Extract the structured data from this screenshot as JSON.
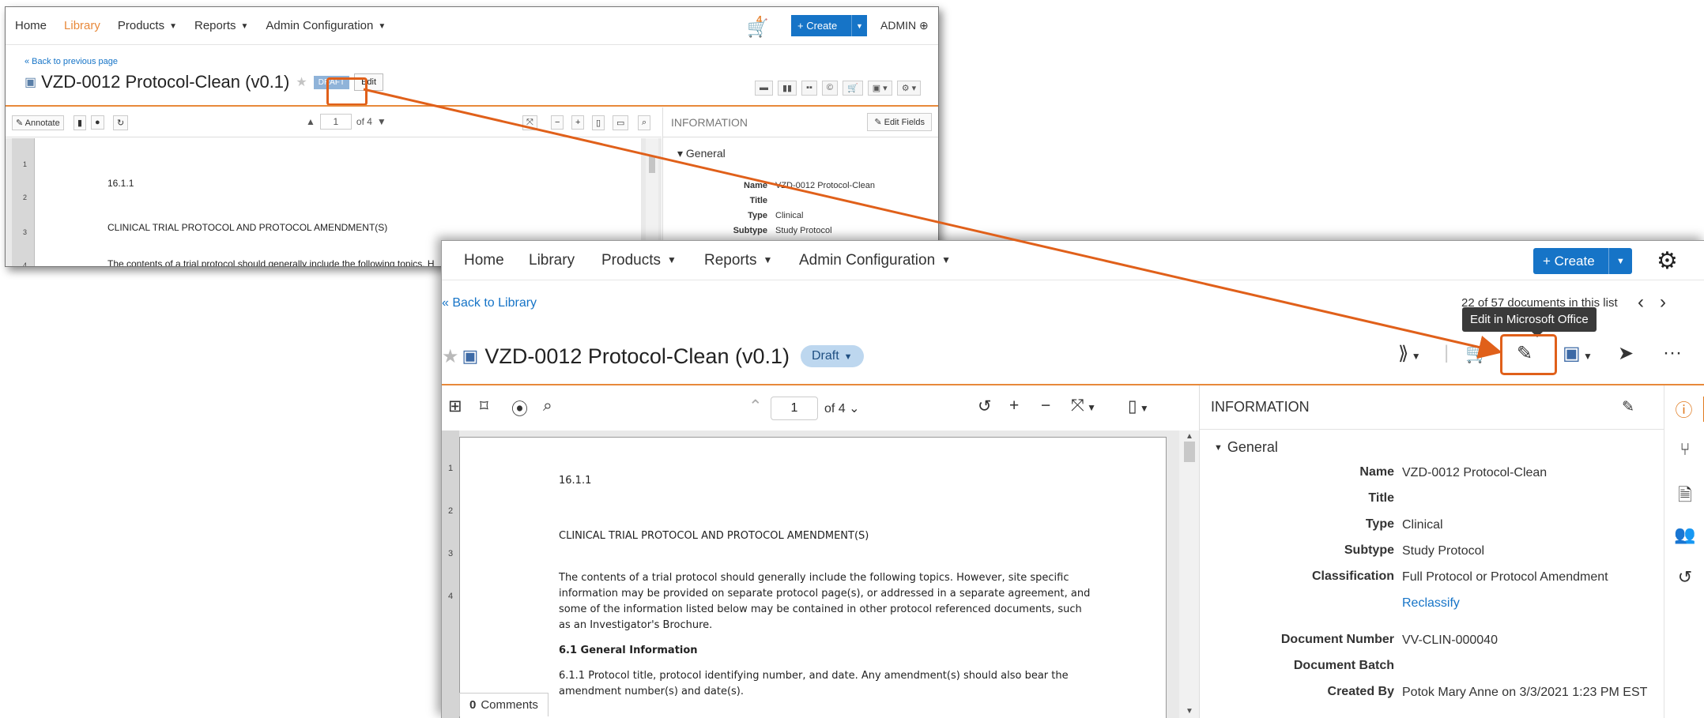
{
  "old": {
    "nav": {
      "home": "Home",
      "library": "Library",
      "products": "Products",
      "reports": "Reports",
      "admin_config": "Admin Configuration"
    },
    "cart_count": "4",
    "create_label": "+ Create",
    "user": "ADMIN",
    "back_link": "« Back to previous page",
    "doc_title": "VZD-0012 Protocol-Clean (v0.1)",
    "draft_label": "DRAFT",
    "edit_label": "Edit",
    "annotate_label": "Annotate",
    "page_current": "1",
    "page_total": "of 4",
    "info_heading": "INFORMATION",
    "edit_fields_label": "Edit Fields",
    "general_label": "General",
    "fields": [
      {
        "k": "Name",
        "v": "VZD-0012 Protocol-Clean"
      },
      {
        "k": "Title",
        "v": ""
      },
      {
        "k": "Type",
        "v": "Clinical"
      },
      {
        "k": "Subtype",
        "v": "Study Protocol"
      }
    ],
    "gutter": [
      "1",
      "2",
      "3",
      "4"
    ],
    "lines": [
      "16.1.1",
      "CLINICAL TRIAL PROTOCOL AND PROTOCOL AMENDMENT(S)",
      "The contents of a trial protocol should generally include the following topics. H"
    ]
  },
  "new": {
    "nav": {
      "home": "Home",
      "library": "Library",
      "products": "Products",
      "reports": "Reports",
      "admin_config": "Admin Configuration"
    },
    "create_label": "+ Create",
    "back_link": "« Back to Library",
    "counter": "22 of 57 documents in this list",
    "tooltip": "Edit in Microsoft Office",
    "doc_title": "VZD-0012 Protocol-Clean (v0.1)",
    "status": "Draft",
    "page_current": "1",
    "page_total": "of 4",
    "comments_count": "0",
    "comments_label": "Comments",
    "info_heading": "INFORMATION",
    "general_label": "General",
    "fields": [
      {
        "k": "Name",
        "v": "VZD-0012 Protocol-Clean"
      },
      {
        "k": "Title",
        "v": ""
      },
      {
        "k": "Type",
        "v": "Clinical"
      },
      {
        "k": "Subtype",
        "v": "Study Protocol"
      },
      {
        "k": "Classification",
        "v": "Full Protocol or Protocol Amendment"
      },
      {
        "k": "",
        "v": "Reclassify"
      },
      {
        "k": "Document Number",
        "v": "VV-CLIN-000040"
      },
      {
        "k": "Document Batch",
        "v": ""
      },
      {
        "k": "Created By",
        "v": "Potok Mary Anne on 3/3/2021 1:23 PM EST"
      }
    ],
    "gutter": [
      "1",
      "2",
      "3",
      "4"
    ],
    "lines": [
      "16.1.1",
      "CLINICAL TRIAL PROTOCOL AND PROTOCOL AMENDMENT(S)",
      "The contents of a trial protocol should generally include the following topics. However, site specific",
      "information may be provided on separate protocol page(s), or addressed in a separate agreement, and",
      "some of the information listed below may be contained in other protocol referenced documents, such",
      "as an Investigator's Brochure.",
      "6.1 General Information",
      "6.1.1 Protocol title, protocol identifying number, and date. Any amendment(s) should also bear the",
      "amendment number(s) and date(s)."
    ]
  },
  "colors": {
    "accent": "#e8893a",
    "highlight": "#e0601a",
    "primary": "#1674c7"
  }
}
